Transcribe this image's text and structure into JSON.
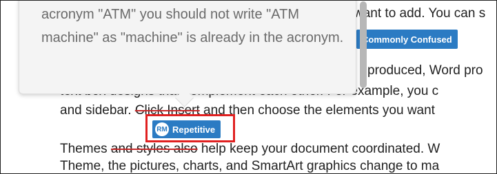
{
  "document": {
    "line1_tail": "want to add. You can s",
    "line2_tail": "produced, Word pro",
    "line3_partial": "text box designs that complement each other. For example, you c",
    "line4_before_strike": "and sidebar. ",
    "line4_strike": "Click Insert",
    "line4_after_strike": " and then choose the elements you want",
    "line5_before_strike": "Themes ",
    "line5_strike": "and styles also",
    "line5_after_strike": " help keep your document coordinated. W",
    "line6": "Theme, the pictures, charts, and SmartArt graphics change to ma"
  },
  "tags": {
    "confused_label": "Commonly Confused",
    "repetitive_badge": "RM",
    "repetitive_label": "Repetitive"
  },
  "tooltip": {
    "text": "acronym \"ATM\" you should not write \"ATM machine\" as \"machine\" is already in the acronym."
  },
  "colors": {
    "tag_blue": "#2b7bc3",
    "highlight_red": "#e02020",
    "strike_red": "#c62828"
  }
}
